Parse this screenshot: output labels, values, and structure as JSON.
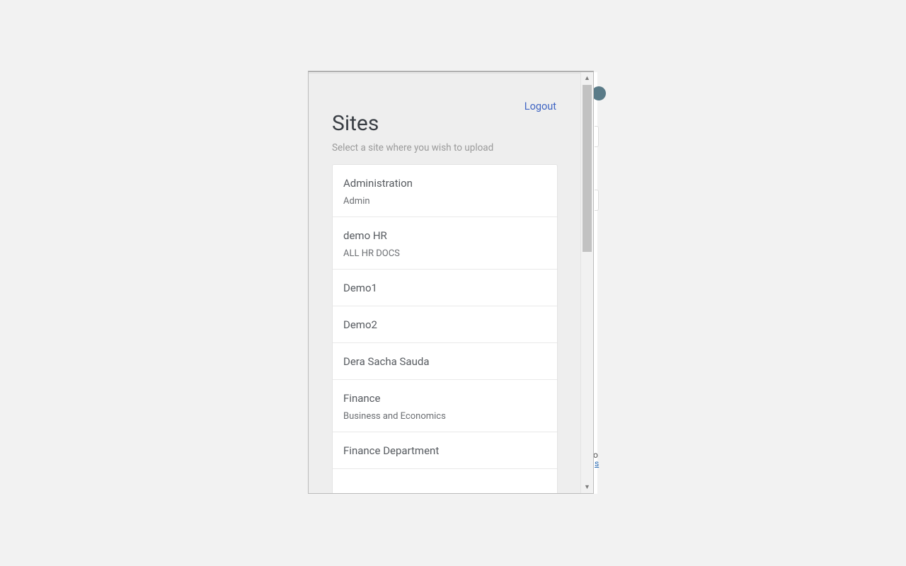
{
  "header": {
    "logout": "Logout",
    "title": "Sites",
    "subtitle": "Select a site where you wish to upload"
  },
  "sites": [
    {
      "title": "Administration",
      "desc": "Admin"
    },
    {
      "title": "demo HR",
      "desc": "ALL HR DOCS"
    },
    {
      "title": "Demo1",
      "desc": ""
    },
    {
      "title": "Demo2",
      "desc": ""
    },
    {
      "title": "Dera Sacha Sauda",
      "desc": ""
    },
    {
      "title": "Finance",
      "desc": "Business and Economics"
    },
    {
      "title": "Finance Department",
      "desc": ""
    }
  ],
  "bg": {
    "t2": "o",
    "t3": "s"
  }
}
